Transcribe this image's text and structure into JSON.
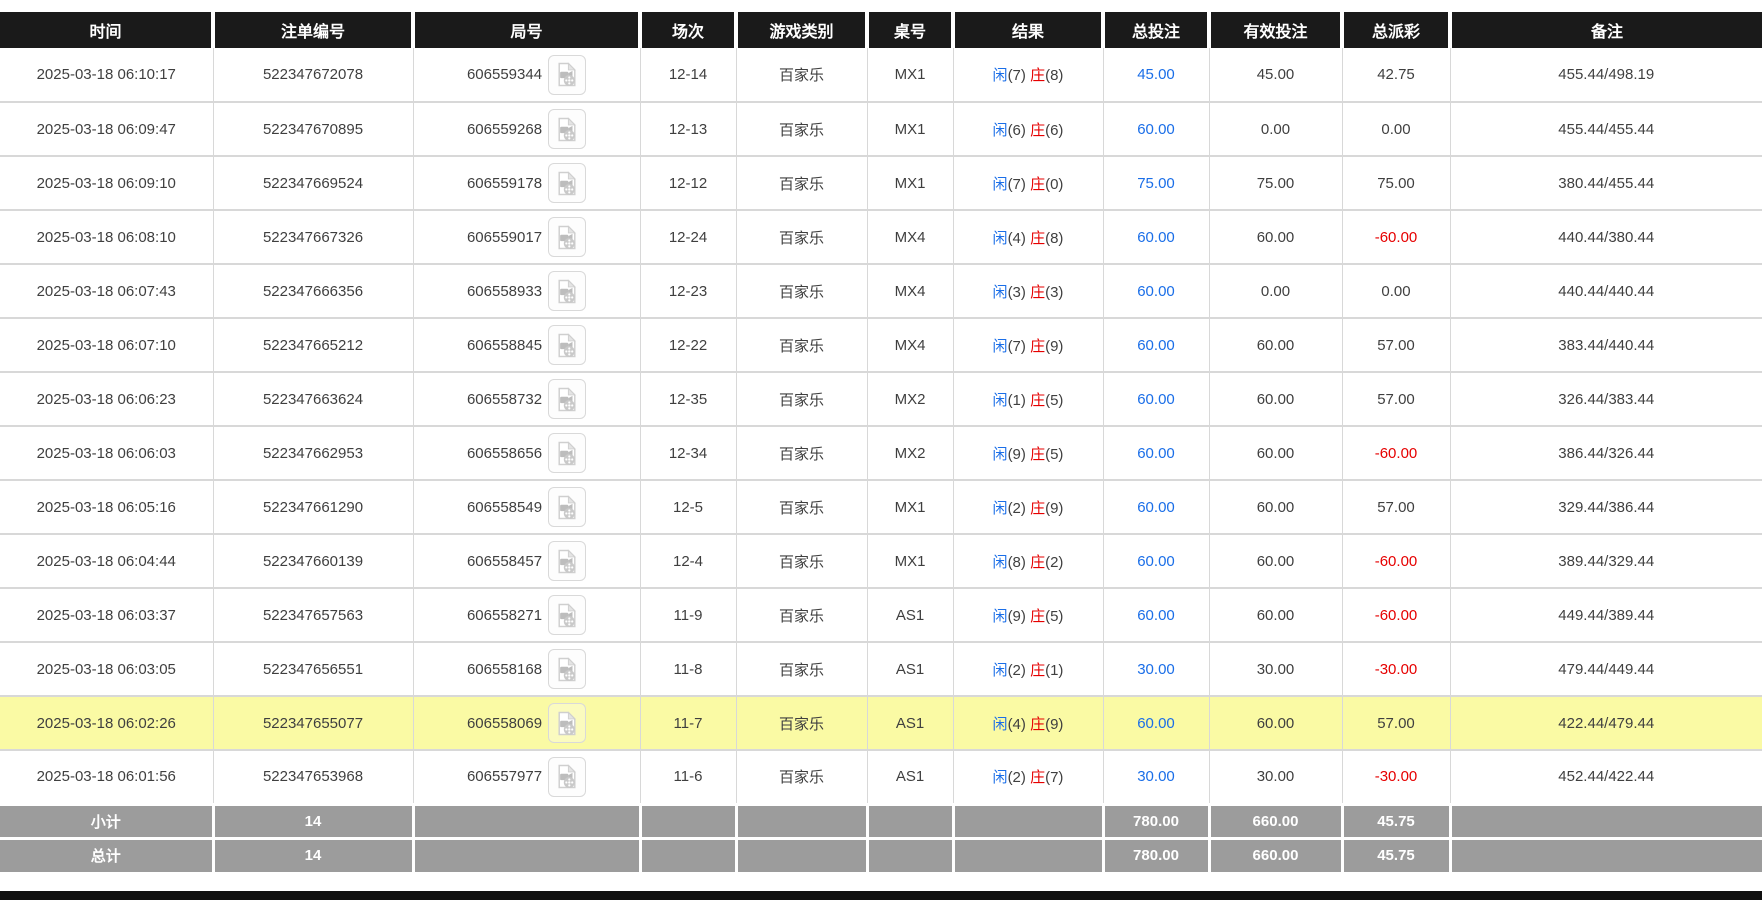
{
  "colors": {
    "header_bg": "#1a1a1a",
    "header_text": "#ffffff",
    "row_border": "#d8d8d8",
    "highlight_row_bg": "#fafaa4",
    "footer_bg": "#9c9c9c",
    "footer_text": "#ffffff",
    "link_blue": "#1a6ee8",
    "loss_red": "#e60000"
  },
  "icons": {
    "round_video": "film-document-icon"
  },
  "labels": {
    "player": "闲",
    "banker": "庄"
  },
  "table": {
    "headers": [
      "时间",
      "注单编号",
      "局号",
      "场次",
      "游戏类别",
      "桌号",
      "结果",
      "总投注",
      "有效投注",
      "总派彩",
      "备注"
    ],
    "rows": [
      {
        "time": "2025-03-18 06:10:17",
        "bet_id": "522347672078",
        "round_no": "606559344",
        "session": "12-14",
        "game_type": "百家乐",
        "table_no": "MX1",
        "player_score": "7",
        "banker_score": "8",
        "total_bet": "45.00",
        "valid_bet": "45.00",
        "total_payout": "42.75",
        "remark": "455.44/498.19",
        "highlighted": false
      },
      {
        "time": "2025-03-18 06:09:47",
        "bet_id": "522347670895",
        "round_no": "606559268",
        "session": "12-13",
        "game_type": "百家乐",
        "table_no": "MX1",
        "player_score": "6",
        "banker_score": "6",
        "total_bet": "60.00",
        "valid_bet": "0.00",
        "total_payout": "0.00",
        "remark": "455.44/455.44",
        "highlighted": false
      },
      {
        "time": "2025-03-18 06:09:10",
        "bet_id": "522347669524",
        "round_no": "606559178",
        "session": "12-12",
        "game_type": "百家乐",
        "table_no": "MX1",
        "player_score": "7",
        "banker_score": "0",
        "total_bet": "75.00",
        "valid_bet": "75.00",
        "total_payout": "75.00",
        "remark": "380.44/455.44",
        "highlighted": false
      },
      {
        "time": "2025-03-18 06:08:10",
        "bet_id": "522347667326",
        "round_no": "606559017",
        "session": "12-24",
        "game_type": "百家乐",
        "table_no": "MX4",
        "player_score": "4",
        "banker_score": "8",
        "total_bet": "60.00",
        "valid_bet": "60.00",
        "total_payout": "-60.00",
        "remark": "440.44/380.44",
        "highlighted": false
      },
      {
        "time": "2025-03-18 06:07:43",
        "bet_id": "522347666356",
        "round_no": "606558933",
        "session": "12-23",
        "game_type": "百家乐",
        "table_no": "MX4",
        "player_score": "3",
        "banker_score": "3",
        "total_bet": "60.00",
        "valid_bet": "0.00",
        "total_payout": "0.00",
        "remark": "440.44/440.44",
        "highlighted": false
      },
      {
        "time": "2025-03-18 06:07:10",
        "bet_id": "522347665212",
        "round_no": "606558845",
        "session": "12-22",
        "game_type": "百家乐",
        "table_no": "MX4",
        "player_score": "7",
        "banker_score": "9",
        "total_bet": "60.00",
        "valid_bet": "60.00",
        "total_payout": "57.00",
        "remark": "383.44/440.44",
        "highlighted": false
      },
      {
        "time": "2025-03-18 06:06:23",
        "bet_id": "522347663624",
        "round_no": "606558732",
        "session": "12-35",
        "game_type": "百家乐",
        "table_no": "MX2",
        "player_score": "1",
        "banker_score": "5",
        "total_bet": "60.00",
        "valid_bet": "60.00",
        "total_payout": "57.00",
        "remark": "326.44/383.44",
        "highlighted": false
      },
      {
        "time": "2025-03-18 06:06:03",
        "bet_id": "522347662953",
        "round_no": "606558656",
        "session": "12-34",
        "game_type": "百家乐",
        "table_no": "MX2",
        "player_score": "9",
        "banker_score": "5",
        "total_bet": "60.00",
        "valid_bet": "60.00",
        "total_payout": "-60.00",
        "remark": "386.44/326.44",
        "highlighted": false
      },
      {
        "time": "2025-03-18 06:05:16",
        "bet_id": "522347661290",
        "round_no": "606558549",
        "session": "12-5",
        "game_type": "百家乐",
        "table_no": "MX1",
        "player_score": "2",
        "banker_score": "9",
        "total_bet": "60.00",
        "valid_bet": "60.00",
        "total_payout": "57.00",
        "remark": "329.44/386.44",
        "highlighted": false
      },
      {
        "time": "2025-03-18 06:04:44",
        "bet_id": "522347660139",
        "round_no": "606558457",
        "session": "12-4",
        "game_type": "百家乐",
        "table_no": "MX1",
        "player_score": "8",
        "banker_score": "2",
        "total_bet": "60.00",
        "valid_bet": "60.00",
        "total_payout": "-60.00",
        "remark": "389.44/329.44",
        "highlighted": false
      },
      {
        "time": "2025-03-18 06:03:37",
        "bet_id": "522347657563",
        "round_no": "606558271",
        "session": "11-9",
        "game_type": "百家乐",
        "table_no": "AS1",
        "player_score": "9",
        "banker_score": "5",
        "total_bet": "60.00",
        "valid_bet": "60.00",
        "total_payout": "-60.00",
        "remark": "449.44/389.44",
        "highlighted": false
      },
      {
        "time": "2025-03-18 06:03:05",
        "bet_id": "522347656551",
        "round_no": "606558168",
        "session": "11-8",
        "game_type": "百家乐",
        "table_no": "AS1",
        "player_score": "2",
        "banker_score": "1",
        "total_bet": "30.00",
        "valid_bet": "30.00",
        "total_payout": "-30.00",
        "remark": "479.44/449.44",
        "highlighted": false
      },
      {
        "time": "2025-03-18 06:02:26",
        "bet_id": "522347655077",
        "round_no": "606558069",
        "session": "11-7",
        "game_type": "百家乐",
        "table_no": "AS1",
        "player_score": "4",
        "banker_score": "9",
        "total_bet": "60.00",
        "valid_bet": "60.00",
        "total_payout": "57.00",
        "remark": "422.44/479.44",
        "highlighted": true
      },
      {
        "time": "2025-03-18 06:01:56",
        "bet_id": "522347653968",
        "round_no": "606557977",
        "session": "11-6",
        "game_type": "百家乐",
        "table_no": "AS1",
        "player_score": "2",
        "banker_score": "7",
        "total_bet": "30.00",
        "valid_bet": "30.00",
        "total_payout": "-30.00",
        "remark": "452.44/422.44",
        "highlighted": false
      }
    ],
    "subtotal": {
      "label": "小计",
      "bet_count": "14",
      "total_bet": "780.00",
      "valid_bet": "660.00",
      "total_payout": "45.75"
    },
    "grand_total": {
      "label": "总计",
      "bet_count": "14",
      "total_bet": "780.00",
      "valid_bet": "660.00",
      "total_payout": "45.75"
    }
  }
}
